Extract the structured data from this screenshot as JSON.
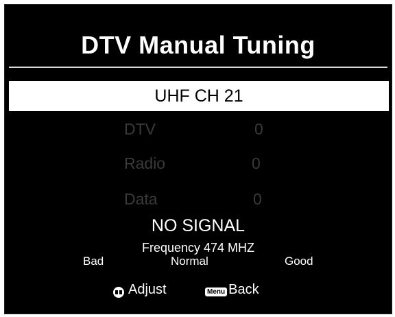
{
  "title": "DTV Manual Tuning",
  "channel": "UHF CH 21",
  "counts": [
    {
      "label": "DTV",
      "value": "0"
    },
    {
      "label": "Radio",
      "value": "0"
    },
    {
      "label": "Data",
      "value": "0"
    }
  ],
  "status": "NO SIGNAL",
  "frequency": "Frequency 474 MHZ",
  "signal_quality": {
    "bad": "Bad",
    "normal": "Normal",
    "good": "Good"
  },
  "hints": {
    "adjust_icon": "left-right-arrows-icon",
    "adjust_label": "Adjust",
    "menu_key": "Menu",
    "back_label": "Back"
  },
  "colors": {
    "background": "#000000",
    "highlight": "#ffffff",
    "disabled_text": "#3a3a3a"
  }
}
